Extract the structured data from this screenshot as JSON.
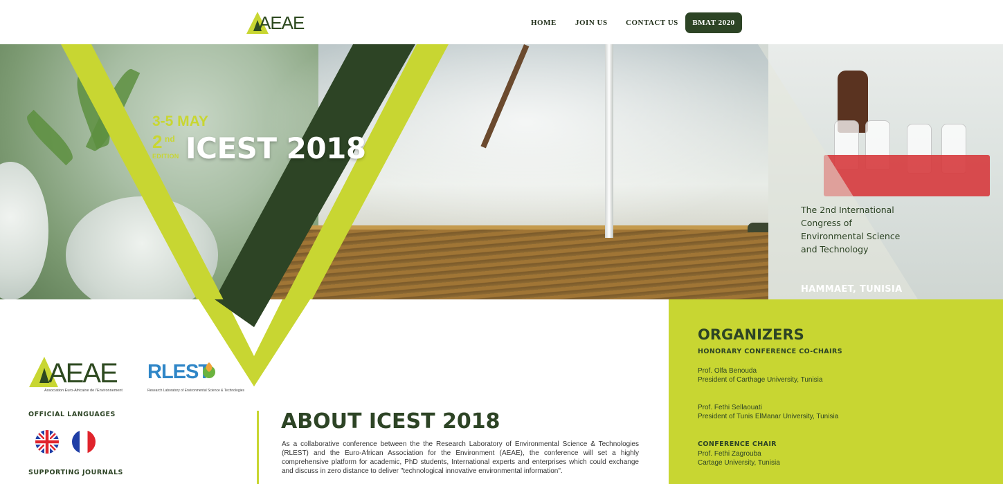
{
  "header": {
    "logo_text": "AEAE",
    "nav": [
      {
        "label": "HOME"
      },
      {
        "label": "JOIN US"
      },
      {
        "label": "CONTACT US"
      },
      {
        "label": "BMAT 2020"
      }
    ]
  },
  "hero": {
    "date": "3-5 MAY",
    "edition_number": "2",
    "edition_suffix": "nd",
    "edition_label": "EDITION",
    "title": "ICEST 2018",
    "subtitle": "The 2nd International Congress of Environmental Science and Technology",
    "location": "HAMMAET, TUNISIA"
  },
  "sidebar": {
    "aeae_logo_text": "AEAE",
    "aeae_logo_sub": "Association Euro-Africaine de l'Environnement",
    "rlest_logo_text": "RLEST",
    "rlest_logo_sub": "Research Laboratory of Environmental Science & Technologies",
    "official_languages_heading": "OFFICIAL LANGUAGES",
    "supporting_journals_heading": "SUPPORTING JOURNALS"
  },
  "about": {
    "title": "ABOUT ICEST 2018",
    "body": "As a collaborative conference between the the Research Laboratory of Environmental Science & Technologies (RLEST) and the Euro-African Association for the Environment (AEAE), the conference will set a highly comprehensive platform for academic, PhD students, International experts and enterprises which could exchange and discuss in zero distance to deliver \"technological innovative environmental information\"."
  },
  "organizers": {
    "title": "ORGANIZERS",
    "honorary_heading": "HONORARY CONFERENCE CO-CHAIRS",
    "honorary": [
      {
        "name": "Prof. Olfa Benouda",
        "role": "President of Carthage University, Tunisia"
      },
      {
        "name": "Prof. Fethi Sellaouati",
        "role": "President of Tunis ElManar University, Tunisia"
      }
    ],
    "chair_heading": "CONFERENCE CHAIR",
    "chair": {
      "name": "Prof. Fethi Zagrouba",
      "role": "Cartage University, Tunisia"
    }
  },
  "colors": {
    "brand_dark_green": "#2d4425",
    "brand_lime": "#c8d632"
  },
  "icons": [
    "aeae-logo-icon",
    "rlest-logo-icon",
    "uk-flag-icon",
    "france-flag-icon"
  ]
}
